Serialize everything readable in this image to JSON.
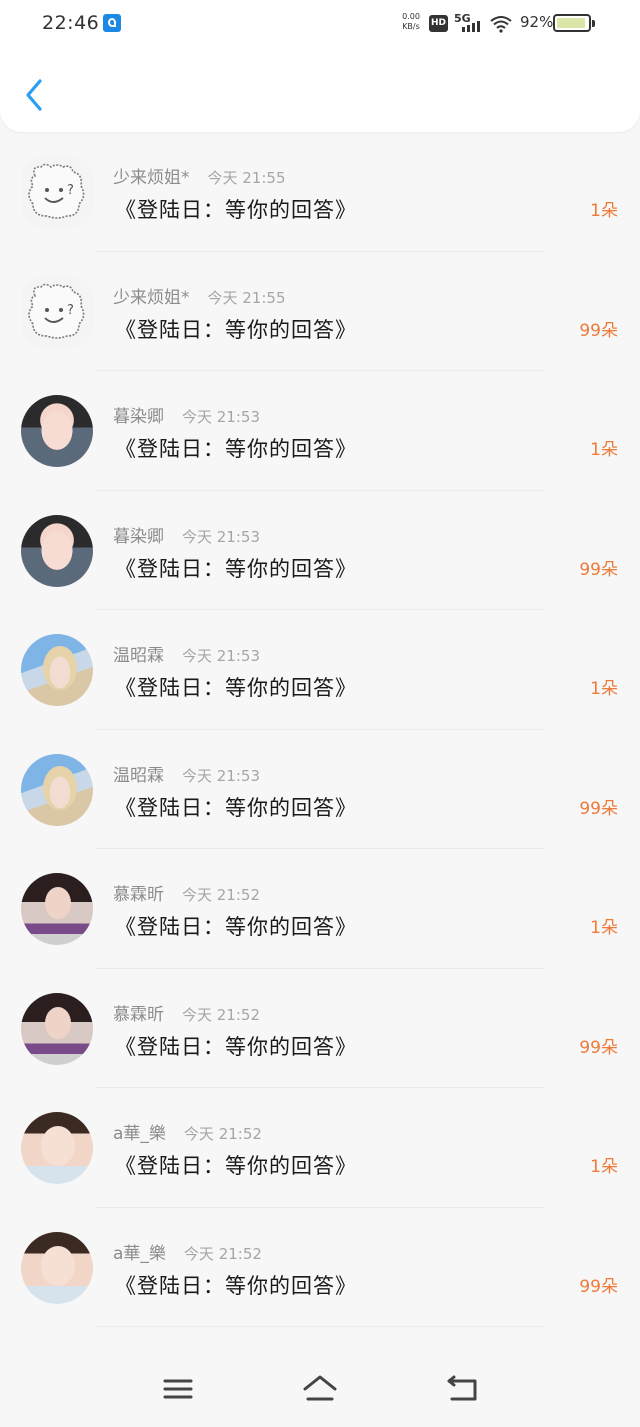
{
  "status_bar": {
    "time": "22:46",
    "net_speed_value": "0.00",
    "net_speed_unit": "KB/s",
    "hd_label": "HD",
    "network_label": "5G",
    "battery_pct": "92%",
    "battery_level": 0.92
  },
  "messages": [
    {
      "name": "少来烦姐*",
      "time": "今天 21:55",
      "text": "《登陆日：等你的回答》",
      "count": "1朵",
      "avatar": "bear"
    },
    {
      "name": "少来烦姐*",
      "time": "今天 21:55",
      "text": "《登陆日：等你的回答》",
      "count": "99朵",
      "avatar": "bear"
    },
    {
      "name": "暮染卿",
      "time": "今天 21:53",
      "text": "《登陆日：等你的回答》",
      "count": "1朵",
      "avatar": "anime"
    },
    {
      "name": "暮染卿",
      "time": "今天 21:53",
      "text": "《登陆日：等你的回答》",
      "count": "99朵",
      "avatar": "anime"
    },
    {
      "name": "温昭霖",
      "time": "今天 21:53",
      "text": "《登陆日：等你的回答》",
      "count": "1朵",
      "avatar": "blonde"
    },
    {
      "name": "温昭霖",
      "time": "今天 21:53",
      "text": "《登陆日：等你的回答》",
      "count": "99朵",
      "avatar": "blonde"
    },
    {
      "name": "慕霖昕",
      "time": "今天 21:52",
      "text": "《登陆日：等你的回答》",
      "count": "1朵",
      "avatar": "dark"
    },
    {
      "name": "慕霖昕",
      "time": "今天 21:52",
      "text": "《登陆日：等你的回答》",
      "count": "99朵",
      "avatar": "dark"
    },
    {
      "name": "a華_樂",
      "time": "今天 21:52",
      "text": "《登陆日：等你的回答》",
      "count": "1朵",
      "avatar": "girl"
    },
    {
      "name": "a華_樂",
      "time": "今天 21:52",
      "text": "《登陆日：等你的回答》",
      "count": "99朵",
      "avatar": "girl"
    }
  ],
  "icons": {
    "back": "chevron-left-icon",
    "menu": "menu-icon",
    "home": "home-icon",
    "return": "return-icon"
  },
  "colors": {
    "accent": "#2a9df4",
    "flower_count": "#ee7a3a",
    "name": "#8c8c8c",
    "message": "#1a1a1a"
  }
}
